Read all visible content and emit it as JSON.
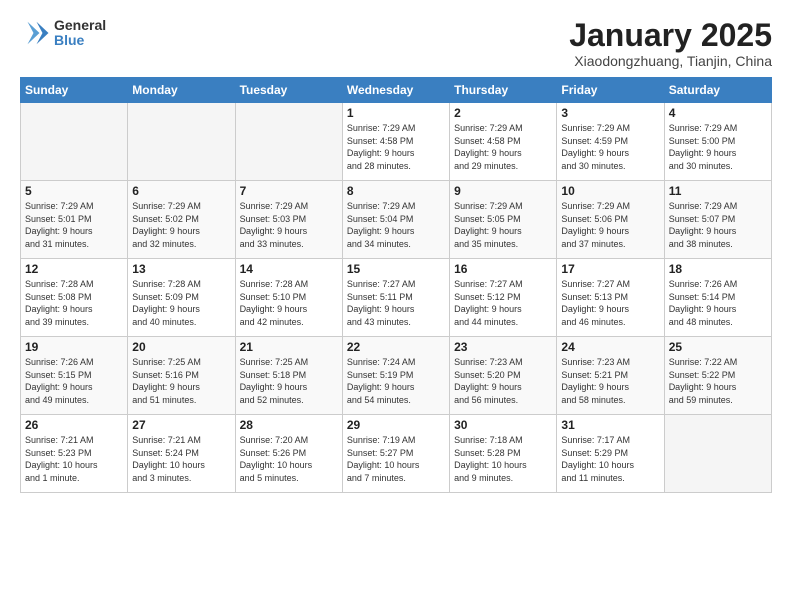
{
  "logo": {
    "general": "General",
    "blue": "Blue"
  },
  "header": {
    "title": "January 2025",
    "subtitle": "Xiaodongzhuang, Tianjin, China"
  },
  "weekdays": [
    "Sunday",
    "Monday",
    "Tuesday",
    "Wednesday",
    "Thursday",
    "Friday",
    "Saturday"
  ],
  "weeks": [
    [
      {
        "day": "",
        "info": ""
      },
      {
        "day": "",
        "info": ""
      },
      {
        "day": "",
        "info": ""
      },
      {
        "day": "1",
        "info": "Sunrise: 7:29 AM\nSunset: 4:58 PM\nDaylight: 9 hours\nand 28 minutes."
      },
      {
        "day": "2",
        "info": "Sunrise: 7:29 AM\nSunset: 4:58 PM\nDaylight: 9 hours\nand 29 minutes."
      },
      {
        "day": "3",
        "info": "Sunrise: 7:29 AM\nSunset: 4:59 PM\nDaylight: 9 hours\nand 30 minutes."
      },
      {
        "day": "4",
        "info": "Sunrise: 7:29 AM\nSunset: 5:00 PM\nDaylight: 9 hours\nand 30 minutes."
      }
    ],
    [
      {
        "day": "5",
        "info": "Sunrise: 7:29 AM\nSunset: 5:01 PM\nDaylight: 9 hours\nand 31 minutes."
      },
      {
        "day": "6",
        "info": "Sunrise: 7:29 AM\nSunset: 5:02 PM\nDaylight: 9 hours\nand 32 minutes."
      },
      {
        "day": "7",
        "info": "Sunrise: 7:29 AM\nSunset: 5:03 PM\nDaylight: 9 hours\nand 33 minutes."
      },
      {
        "day": "8",
        "info": "Sunrise: 7:29 AM\nSunset: 5:04 PM\nDaylight: 9 hours\nand 34 minutes."
      },
      {
        "day": "9",
        "info": "Sunrise: 7:29 AM\nSunset: 5:05 PM\nDaylight: 9 hours\nand 35 minutes."
      },
      {
        "day": "10",
        "info": "Sunrise: 7:29 AM\nSunset: 5:06 PM\nDaylight: 9 hours\nand 37 minutes."
      },
      {
        "day": "11",
        "info": "Sunrise: 7:29 AM\nSunset: 5:07 PM\nDaylight: 9 hours\nand 38 minutes."
      }
    ],
    [
      {
        "day": "12",
        "info": "Sunrise: 7:28 AM\nSunset: 5:08 PM\nDaylight: 9 hours\nand 39 minutes."
      },
      {
        "day": "13",
        "info": "Sunrise: 7:28 AM\nSunset: 5:09 PM\nDaylight: 9 hours\nand 40 minutes."
      },
      {
        "day": "14",
        "info": "Sunrise: 7:28 AM\nSunset: 5:10 PM\nDaylight: 9 hours\nand 42 minutes."
      },
      {
        "day": "15",
        "info": "Sunrise: 7:27 AM\nSunset: 5:11 PM\nDaylight: 9 hours\nand 43 minutes."
      },
      {
        "day": "16",
        "info": "Sunrise: 7:27 AM\nSunset: 5:12 PM\nDaylight: 9 hours\nand 44 minutes."
      },
      {
        "day": "17",
        "info": "Sunrise: 7:27 AM\nSunset: 5:13 PM\nDaylight: 9 hours\nand 46 minutes."
      },
      {
        "day": "18",
        "info": "Sunrise: 7:26 AM\nSunset: 5:14 PM\nDaylight: 9 hours\nand 48 minutes."
      }
    ],
    [
      {
        "day": "19",
        "info": "Sunrise: 7:26 AM\nSunset: 5:15 PM\nDaylight: 9 hours\nand 49 minutes."
      },
      {
        "day": "20",
        "info": "Sunrise: 7:25 AM\nSunset: 5:16 PM\nDaylight: 9 hours\nand 51 minutes."
      },
      {
        "day": "21",
        "info": "Sunrise: 7:25 AM\nSunset: 5:18 PM\nDaylight: 9 hours\nand 52 minutes."
      },
      {
        "day": "22",
        "info": "Sunrise: 7:24 AM\nSunset: 5:19 PM\nDaylight: 9 hours\nand 54 minutes."
      },
      {
        "day": "23",
        "info": "Sunrise: 7:23 AM\nSunset: 5:20 PM\nDaylight: 9 hours\nand 56 minutes."
      },
      {
        "day": "24",
        "info": "Sunrise: 7:23 AM\nSunset: 5:21 PM\nDaylight: 9 hours\nand 58 minutes."
      },
      {
        "day": "25",
        "info": "Sunrise: 7:22 AM\nSunset: 5:22 PM\nDaylight: 9 hours\nand 59 minutes."
      }
    ],
    [
      {
        "day": "26",
        "info": "Sunrise: 7:21 AM\nSunset: 5:23 PM\nDaylight: 10 hours\nand 1 minute."
      },
      {
        "day": "27",
        "info": "Sunrise: 7:21 AM\nSunset: 5:24 PM\nDaylight: 10 hours\nand 3 minutes."
      },
      {
        "day": "28",
        "info": "Sunrise: 7:20 AM\nSunset: 5:26 PM\nDaylight: 10 hours\nand 5 minutes."
      },
      {
        "day": "29",
        "info": "Sunrise: 7:19 AM\nSunset: 5:27 PM\nDaylight: 10 hours\nand 7 minutes."
      },
      {
        "day": "30",
        "info": "Sunrise: 7:18 AM\nSunset: 5:28 PM\nDaylight: 10 hours\nand 9 minutes."
      },
      {
        "day": "31",
        "info": "Sunrise: 7:17 AM\nSunset: 5:29 PM\nDaylight: 10 hours\nand 11 minutes."
      },
      {
        "day": "",
        "info": ""
      }
    ]
  ]
}
